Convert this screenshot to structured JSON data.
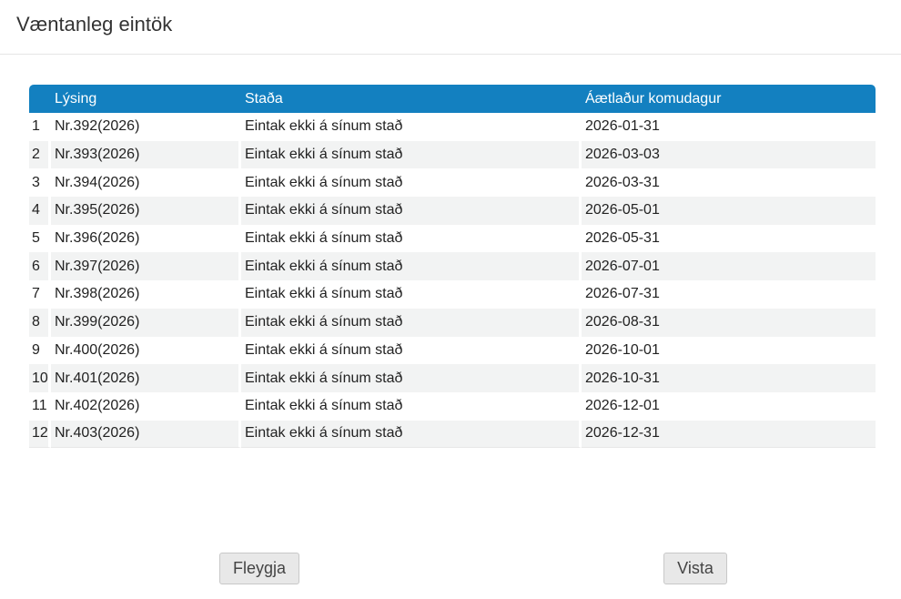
{
  "dialog": {
    "title": "Væntanleg eintök"
  },
  "table": {
    "headers": [
      "",
      "Lýsing",
      "Staða",
      "Áætlaður komudagur"
    ],
    "rows": [
      {
        "num": "1",
        "desc": "Nr.392(2026)",
        "status": "Eintak ekki á sínum stað",
        "date": "2026-01-31"
      },
      {
        "num": "2",
        "desc": "Nr.393(2026)",
        "status": "Eintak ekki á sínum stað",
        "date": "2026-03-03"
      },
      {
        "num": "3",
        "desc": "Nr.394(2026)",
        "status": "Eintak ekki á sínum stað",
        "date": "2026-03-31"
      },
      {
        "num": "4",
        "desc": "Nr.395(2026)",
        "status": "Eintak ekki á sínum stað",
        "date": "2026-05-01"
      },
      {
        "num": "5",
        "desc": "Nr.396(2026)",
        "status": "Eintak ekki á sínum stað",
        "date": "2026-05-31"
      },
      {
        "num": "6",
        "desc": "Nr.397(2026)",
        "status": "Eintak ekki á sínum stað",
        "date": "2026-07-01"
      },
      {
        "num": "7",
        "desc": "Nr.398(2026)",
        "status": "Eintak ekki á sínum stað",
        "date": "2026-07-31"
      },
      {
        "num": "8",
        "desc": "Nr.399(2026)",
        "status": "Eintak ekki á sínum stað",
        "date": "2026-08-31"
      },
      {
        "num": "9",
        "desc": "Nr.400(2026)",
        "status": "Eintak ekki á sínum stað",
        "date": "2026-10-01"
      },
      {
        "num": "10",
        "desc": "Nr.401(2026)",
        "status": "Eintak ekki á sínum stað",
        "date": "2026-10-31"
      },
      {
        "num": "11",
        "desc": "Nr.402(2026)",
        "status": "Eintak ekki á sínum stað",
        "date": "2026-12-01"
      },
      {
        "num": "12",
        "desc": "Nr.403(2026)",
        "status": "Eintak ekki á sínum stað",
        "date": "2026-12-31"
      }
    ]
  },
  "buttons": {
    "discard_label": "Fleygja",
    "save_label": "Vista"
  },
  "colors": {
    "header_bg": "#1380c0",
    "row_alt_bg": "#f2f3f3"
  }
}
